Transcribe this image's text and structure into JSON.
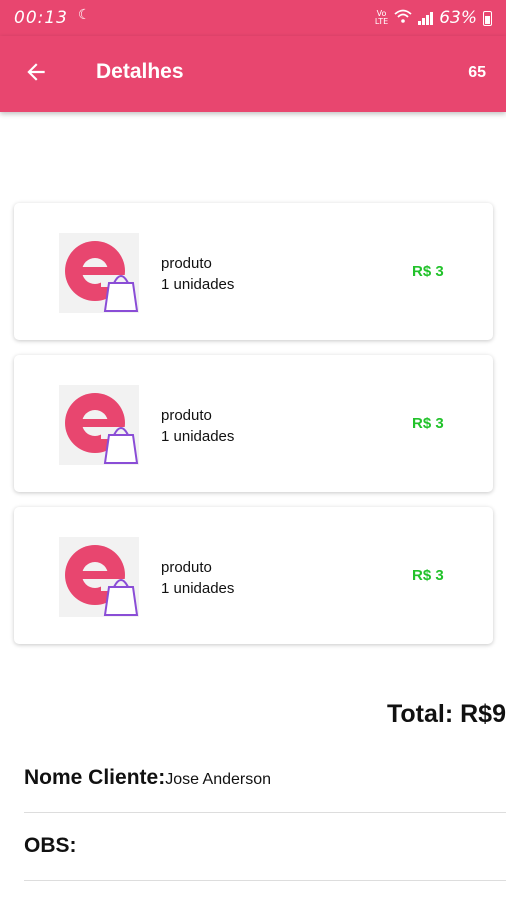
{
  "status_bar": {
    "time": "00:13",
    "volte_top": "Vo",
    "volte_bottom": "LTE",
    "battery": "63%"
  },
  "app_bar": {
    "title": "Detalhes",
    "badge": "65",
    "background_color": "#e8466f"
  },
  "items": [
    {
      "name": "produto",
      "quantity": "1 unidades",
      "price": "R$ 3"
    },
    {
      "name": "produto",
      "quantity": "1 unidades",
      "price": "R$ 3"
    },
    {
      "name": "produto",
      "quantity": "1 unidades",
      "price": "R$ 3"
    }
  ],
  "total": "Total: R$9",
  "client": {
    "label": "Nome Cliente:",
    "value": "Jose Anderson"
  },
  "obs": {
    "label": "OBS:"
  },
  "colors": {
    "accent": "#e8466f",
    "price": "#22c22b",
    "bag": "#8a4dd6"
  }
}
